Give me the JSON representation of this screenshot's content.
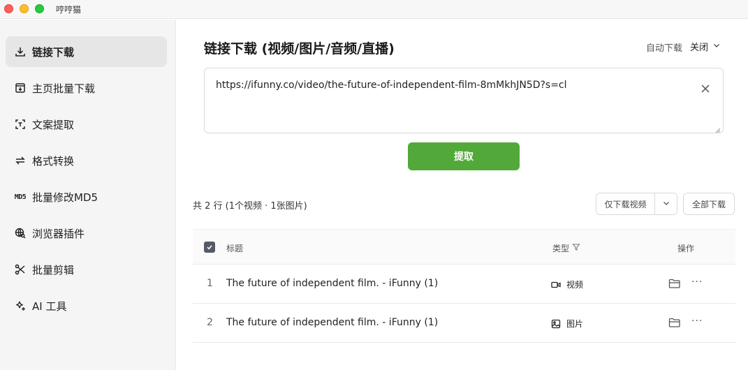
{
  "app": {
    "title": "哼哼猫"
  },
  "sidebar": {
    "items": [
      {
        "label": "链接下载",
        "icon": "download-icon",
        "active": true
      },
      {
        "label": "主页批量下载",
        "icon": "batch-download-icon",
        "active": false
      },
      {
        "label": "文案提取",
        "icon": "text-extract-icon",
        "active": false
      },
      {
        "label": "格式转换",
        "icon": "convert-icon",
        "active": false
      },
      {
        "label": "批量修改MD5",
        "icon": "md5-icon",
        "icon_text": "MD5",
        "active": false
      },
      {
        "label": "浏览器插件",
        "icon": "browser-extension-icon",
        "active": false
      },
      {
        "label": "批量剪辑",
        "icon": "scissors-icon",
        "active": false
      },
      {
        "label": "AI 工具",
        "icon": "sparkle-icon",
        "active": false
      }
    ]
  },
  "main": {
    "title": "链接下载 (视频/图片/音频/直播)",
    "auto_download_label": "自动下载",
    "auto_download_value": "关闭",
    "url_value": "https://ifunny.co/video/the-future-of-independent-film-8mMkhJN5D?s=cl",
    "extract_button": "提取",
    "summary": "共 2 行 (1个视频 · 1张图片)",
    "download_video_only": "仅下载视频",
    "download_all": "全部下载",
    "accent_color": "#52a939"
  },
  "table": {
    "headers": {
      "title": "标题",
      "type": "类型",
      "action": "操作"
    },
    "rows": [
      {
        "index": "1",
        "title": "The future of independent film. - iFunny (1)",
        "type": "视频",
        "type_icon": "video-icon"
      },
      {
        "index": "2",
        "title": "The future of independent film. - iFunny (1)",
        "type": "图片",
        "type_icon": "image-icon"
      }
    ],
    "more_glyph": "···"
  }
}
